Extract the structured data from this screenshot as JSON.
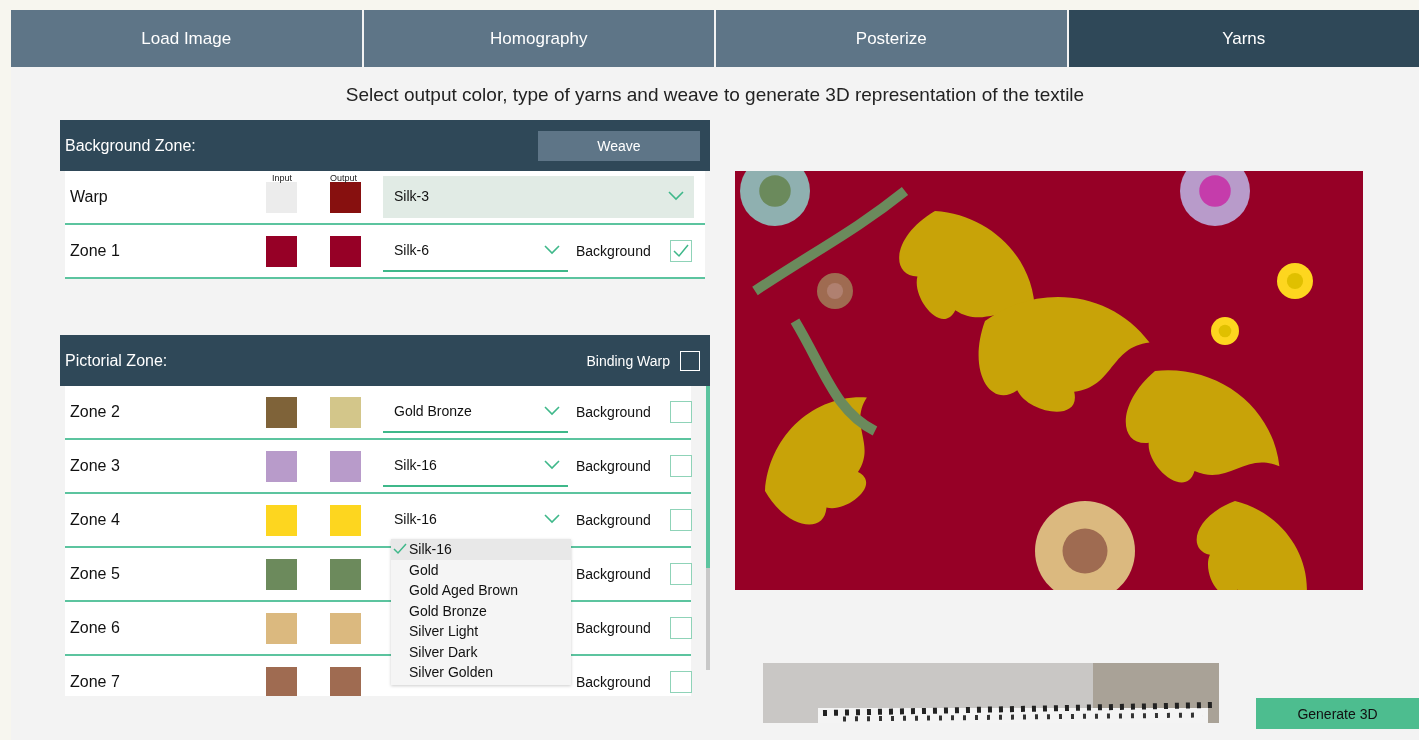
{
  "tabs": [
    {
      "label": "Load Image",
      "selected": false
    },
    {
      "label": "Homography",
      "selected": false
    },
    {
      "label": "Posterize",
      "selected": false
    },
    {
      "label": "Yarns",
      "selected": true
    }
  ],
  "instruction": "Select output color, type of yarns and weave to generate 3D representation of the textile",
  "background_zone": {
    "title": "Background Zone:",
    "weave_button": "Weave",
    "column_headers": [
      "Input",
      "Output"
    ],
    "rows": [
      {
        "kind": "warp",
        "name": "Warp",
        "input": {
          "color": "#ececec"
        },
        "output": {
          "color": "#87100f"
        },
        "yarn": "Silk-3"
      },
      {
        "kind": "zone",
        "name": "Zone 1",
        "input": {
          "color": "#960026"
        },
        "output": {
          "color": "#960026"
        },
        "yarn": "Silk-6",
        "open": false,
        "background_label": "Background",
        "background_checked": true
      }
    ]
  },
  "pictorial_zone": {
    "title": "Pictorial Zone:",
    "binding_warp": {
      "label": "Binding Warp",
      "checked": false
    },
    "rows": [
      {
        "kind": "zone",
        "name": "Zone 2",
        "input": {
          "color": "#7f6339"
        },
        "output": {
          "color": "#d3c68a"
        },
        "yarn": "Gold Bronze",
        "open": false,
        "background_label": "Background",
        "background_checked": false
      },
      {
        "kind": "zone",
        "name": "Zone 3",
        "input": {
          "color": "#b89bca"
        },
        "output": {
          "color": "#b89bca"
        },
        "yarn": "Silk-16",
        "open": false,
        "background_label": "Background",
        "background_checked": false
      },
      {
        "kind": "zone",
        "name": "Zone 4",
        "input": {
          "color": "#fdd61f"
        },
        "output": {
          "color": "#fdd61f"
        },
        "yarn": "Silk-16",
        "open": true,
        "background_label": "Background",
        "background_checked": false
      },
      {
        "kind": "zone",
        "name": "Zone 5",
        "input": {
          "color": "#6c8a5c"
        },
        "output": {
          "color": "#6c8a5c"
        },
        "background_label": "Background",
        "background_checked": false
      },
      {
        "kind": "zone",
        "name": "Zone 6",
        "input": {
          "color": "#dbb97f"
        },
        "output": {
          "color": "#dbb97f"
        },
        "background_label": "Background",
        "background_checked": false
      },
      {
        "kind": "zone",
        "name": "Zone 7",
        "input": {
          "color": "#9f6b51"
        },
        "output": {
          "color": "#9f6b51"
        },
        "background_label": "Background",
        "background_checked": false
      }
    ],
    "dropdown_menu": {
      "options": [
        {
          "label": "Silk-16",
          "selected": true
        },
        {
          "label": "Gold",
          "selected": false
        },
        {
          "label": "Gold Aged Brown",
          "selected": false
        },
        {
          "label": "Gold Bronze",
          "selected": false
        },
        {
          "label": "Silver Light",
          "selected": false
        },
        {
          "label": "Silver Dark",
          "selected": false
        },
        {
          "label": "Silver Golden",
          "selected": false
        }
      ]
    }
  },
  "generate_button": "Generate 3D"
}
